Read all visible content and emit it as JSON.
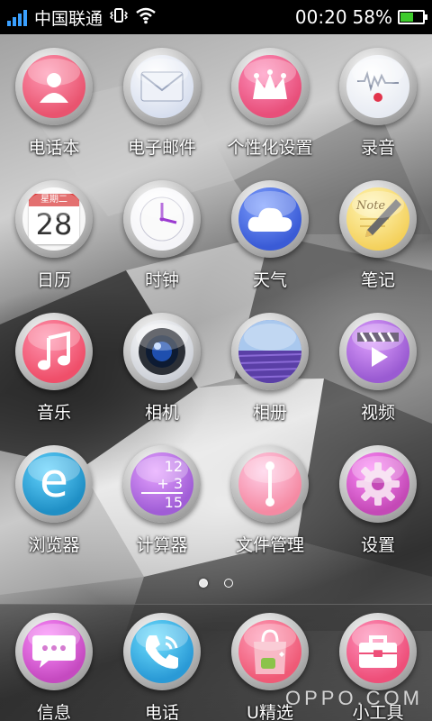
{
  "status_bar": {
    "carrier": "中国联通",
    "time": "00:20",
    "battery_percent": "58%",
    "battery_level": 0.58,
    "signal_bars": 4
  },
  "apps": [
    {
      "label": "电话本",
      "icon": "contacts-icon",
      "color": "#e9546f"
    },
    {
      "label": "电子邮件",
      "icon": "email-icon",
      "color": "#c9d3e8"
    },
    {
      "label": "个性化设置",
      "icon": "theme-crown-icon",
      "color": "#e84f7a"
    },
    {
      "label": "录音",
      "icon": "recorder-icon",
      "color": "#dfe4ee"
    },
    {
      "label": "日历",
      "icon": "calendar-icon",
      "color": "#f2f2f2",
      "calendar_weekday": "星期二",
      "calendar_day": "28"
    },
    {
      "label": "时钟",
      "icon": "clock-icon",
      "color": "#f0f0f5"
    },
    {
      "label": "天气",
      "icon": "weather-cloud-icon",
      "color": "#3a5bd6"
    },
    {
      "label": "笔记",
      "icon": "notes-pen-icon",
      "color": "#f2c63a",
      "note_text": "Note"
    },
    {
      "label": "音乐",
      "icon": "music-note-icon",
      "color": "#ef4f6a"
    },
    {
      "label": "相机",
      "icon": "camera-lens-icon",
      "color": "#d8dbe0"
    },
    {
      "label": "相册",
      "icon": "gallery-lavender-icon",
      "color": "#6d6fcf"
    },
    {
      "label": "视频",
      "icon": "video-play-icon",
      "color": "#9a5bd2"
    },
    {
      "label": "浏览器",
      "icon": "browser-e-icon",
      "color": "#1f8fc5"
    },
    {
      "label": "计算器",
      "icon": "calculator-icon",
      "color": "#a05dd6",
      "calc_top": "12",
      "calc_mid": "+ 3",
      "calc_result": "15"
    },
    {
      "label": "文件管理",
      "icon": "file-manager-icon",
      "color": "#f58aa3"
    },
    {
      "label": "设置",
      "icon": "settings-gear-icon",
      "color": "#c449b6"
    }
  ],
  "dock": [
    {
      "label": "信息",
      "icon": "messages-icon",
      "color": "#c54ac0"
    },
    {
      "label": "电话",
      "icon": "phone-icon",
      "color": "#2a9ad6"
    },
    {
      "label": "U精选",
      "icon": "ustore-bag-icon",
      "color": "#ef5a76"
    },
    {
      "label": "小工具",
      "icon": "toolbox-icon",
      "color": "#ee4f79"
    }
  ],
  "pager": {
    "pages": 2,
    "active": 0
  },
  "watermark": "OPPO.COM"
}
